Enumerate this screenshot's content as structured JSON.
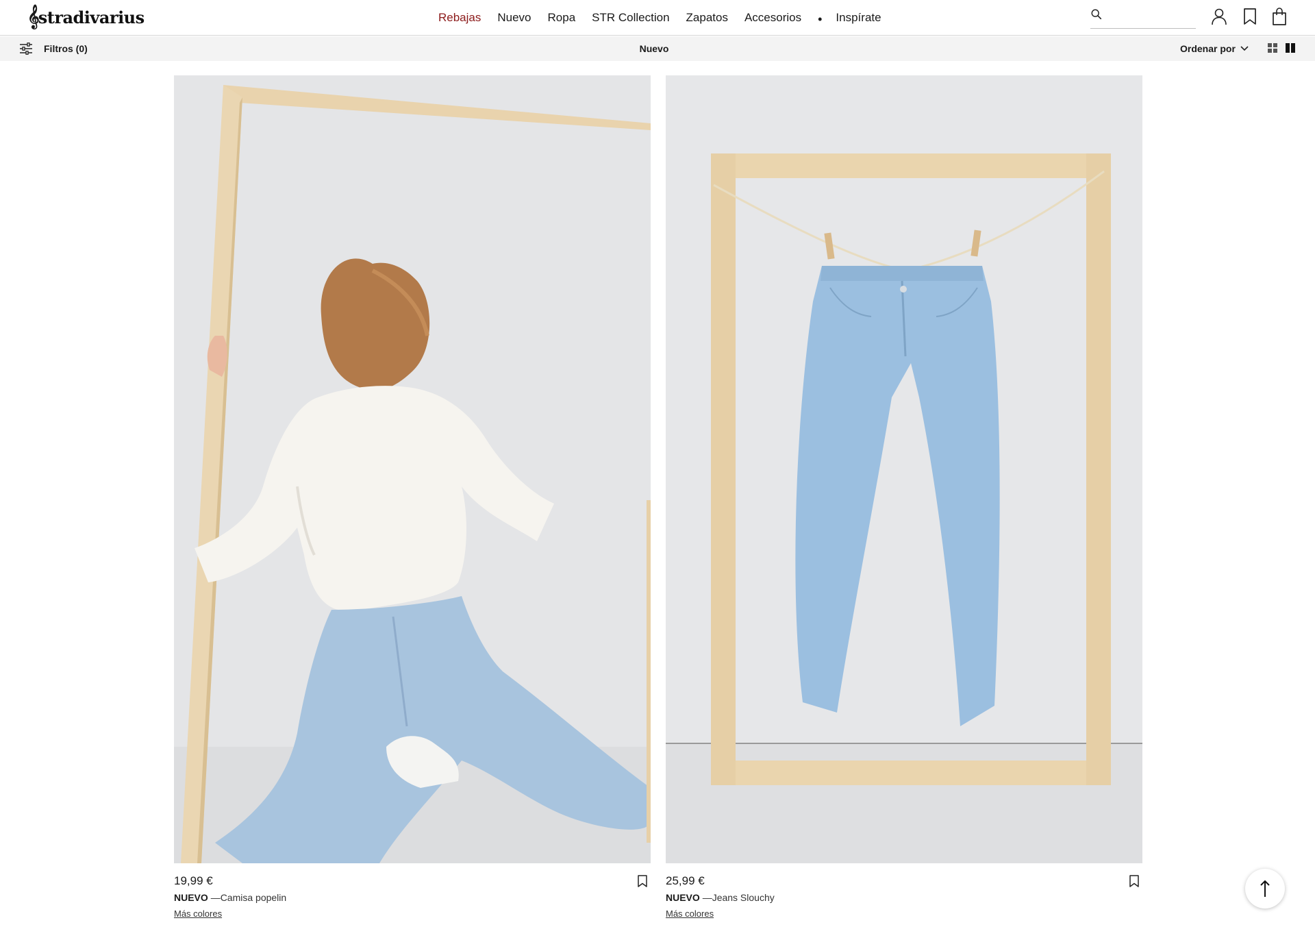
{
  "header": {
    "logo_text": "stradivarius",
    "nav": [
      {
        "label": "Rebajas"
      },
      {
        "label": "Nuevo"
      },
      {
        "label": "Ropa"
      },
      {
        "label": "STR Collection"
      },
      {
        "label": "Zapatos"
      },
      {
        "label": "Accesorios"
      },
      {
        "label": "Inspírate"
      }
    ],
    "search_value": "",
    "sale_color": "#8c1a1a"
  },
  "subbar": {
    "filters_label": "Filtros (0)",
    "title": "Nuevo",
    "sort_label": "Ordenar por"
  },
  "products": [
    {
      "price": "19,99 €",
      "badge": "NUEVO",
      "name": "—Camisa popelin",
      "more": "Más colores"
    },
    {
      "price": "25,99 €",
      "badge": "NUEVO",
      "name": "—Jeans Slouchy",
      "more": "Más colores"
    }
  ],
  "icons": {
    "search": "search-icon",
    "account": "user-icon",
    "wishlist": "bookmark-icon",
    "cart": "shopping-bag-icon",
    "filters": "sliders-icon",
    "sort": "chevron-down-icon",
    "grid": "grid-view-icon",
    "columns": "two-column-view-icon",
    "scroll_top": "arrow-up-icon"
  }
}
